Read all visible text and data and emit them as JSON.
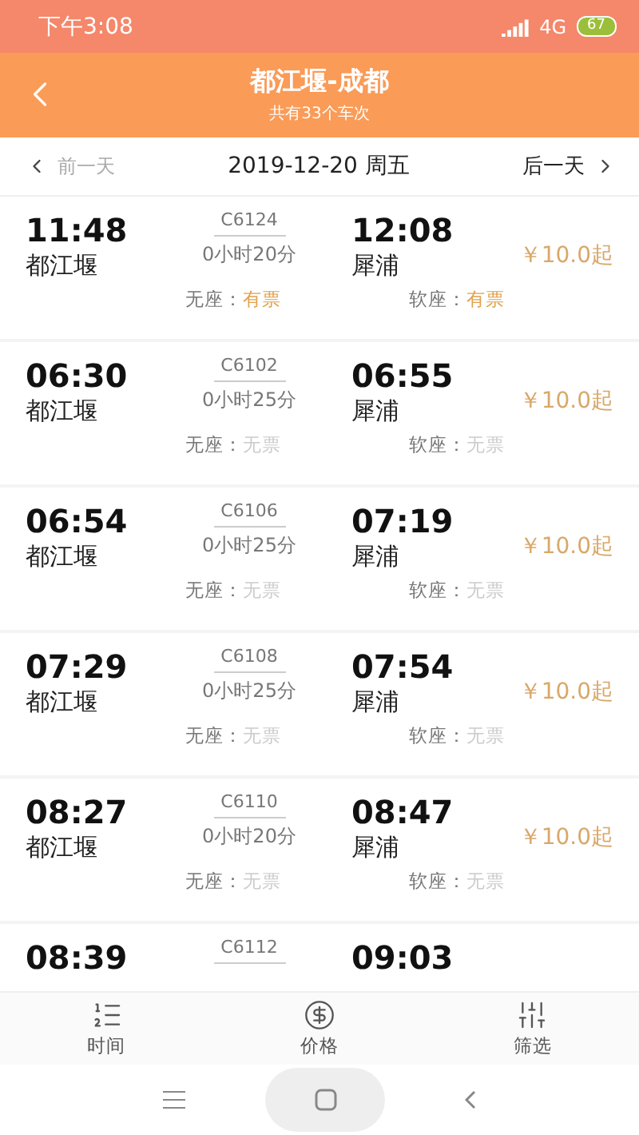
{
  "status_bar": {
    "time": "下午3:08",
    "network": "4G",
    "battery": "67"
  },
  "header": {
    "title": "都江堰-成都",
    "subtitle": "共有33个车次"
  },
  "date_bar": {
    "prev": "前一天",
    "date": "2019-12-20 周五",
    "next": "后一天",
    "prev_disabled": true
  },
  "trains": [
    {
      "depart_time": "11:48",
      "depart_station": "都江堰",
      "code": "C6124",
      "duration": "0小时20分",
      "arrive_time": "12:08",
      "arrive_station": "犀浦",
      "price_symbol": "￥",
      "price": "10.0",
      "price_suffix": "起",
      "seats": [
        {
          "label": "无座：",
          "status": "有票",
          "available": true
        },
        {
          "label": "软座：",
          "status": "有票",
          "available": true
        }
      ]
    },
    {
      "depart_time": "06:30",
      "depart_station": "都江堰",
      "code": "C6102",
      "duration": "0小时25分",
      "arrive_time": "06:55",
      "arrive_station": "犀浦",
      "price_symbol": "￥",
      "price": "10.0",
      "price_suffix": "起",
      "seats": [
        {
          "label": "无座：",
          "status": "无票",
          "available": false
        },
        {
          "label": "软座：",
          "status": "无票",
          "available": false
        }
      ]
    },
    {
      "depart_time": "06:54",
      "depart_station": "都江堰",
      "code": "C6106",
      "duration": "0小时25分",
      "arrive_time": "07:19",
      "arrive_station": "犀浦",
      "price_symbol": "￥",
      "price": "10.0",
      "price_suffix": "起",
      "seats": [
        {
          "label": "无座：",
          "status": "无票",
          "available": false
        },
        {
          "label": "软座：",
          "status": "无票",
          "available": false
        }
      ]
    },
    {
      "depart_time": "07:29",
      "depart_station": "都江堰",
      "code": "C6108",
      "duration": "0小时25分",
      "arrive_time": "07:54",
      "arrive_station": "犀浦",
      "price_symbol": "￥",
      "price": "10.0",
      "price_suffix": "起",
      "seats": [
        {
          "label": "无座：",
          "status": "无票",
          "available": false
        },
        {
          "label": "软座：",
          "status": "无票",
          "available": false
        }
      ]
    },
    {
      "depart_time": "08:27",
      "depart_station": "都江堰",
      "code": "C6110",
      "duration": "0小时20分",
      "arrive_time": "08:47",
      "arrive_station": "犀浦",
      "price_symbol": "￥",
      "price": "10.0",
      "price_suffix": "起",
      "seats": [
        {
          "label": "无座：",
          "status": "无票",
          "available": false
        },
        {
          "label": "软座：",
          "status": "无票",
          "available": false
        }
      ]
    },
    {
      "depart_time": "08:39",
      "code": "C6112",
      "arrive_time": "09:03"
    }
  ],
  "bottom_tabs": [
    {
      "label": "时间",
      "kind": "time"
    },
    {
      "label": "价格",
      "kind": "price"
    },
    {
      "label": "筛选",
      "kind": "filter"
    }
  ]
}
